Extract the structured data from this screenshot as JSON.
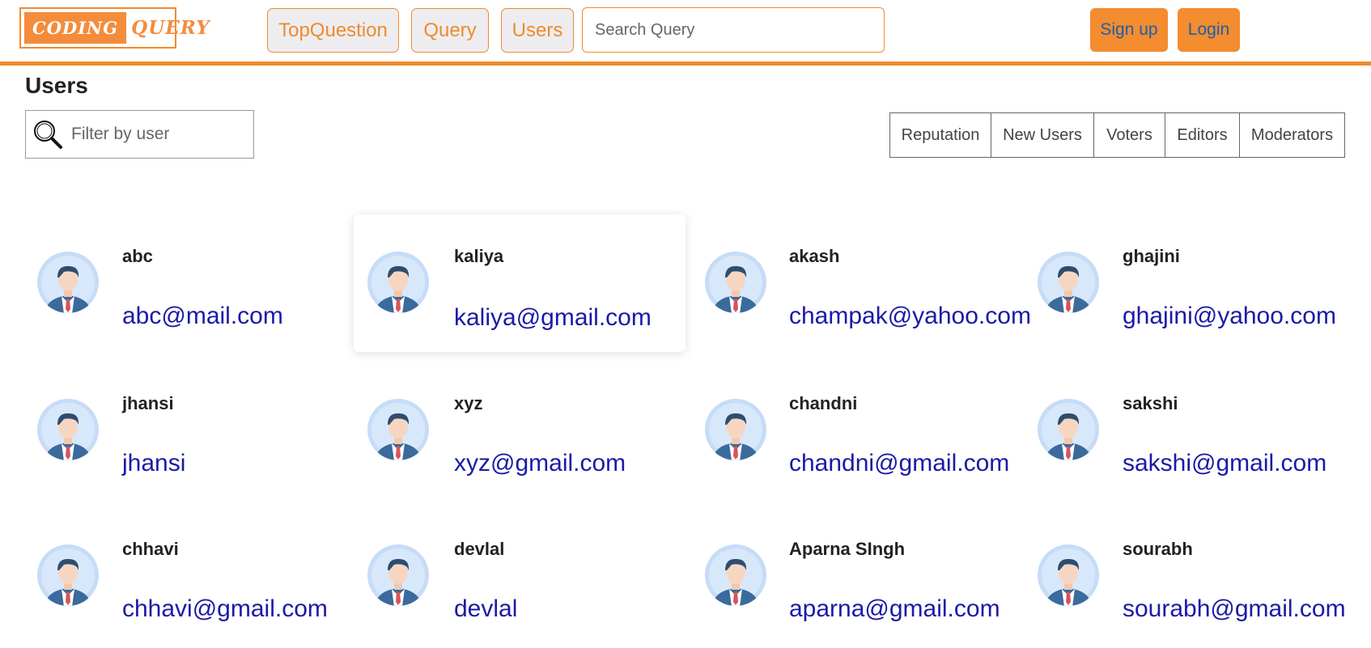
{
  "header": {
    "logo_left": "CODING",
    "logo_right": "QUERY",
    "nav": [
      "TopQuestion",
      "Query",
      "Users"
    ],
    "search_placeholder": "Search Query",
    "signup": "Sign up",
    "login": "Login"
  },
  "colors": {
    "accent": "#f08a2c",
    "link": "#1a1aa8",
    "auth_text": "#1a5faa"
  },
  "page": {
    "title": "Users",
    "filter_placeholder": "Filter by user",
    "tabs": [
      "Reputation",
      "New Users",
      "Voters",
      "Editors",
      "Moderators"
    ]
  },
  "users": [
    {
      "name": "abc",
      "email": "abc@mail.com"
    },
    {
      "name": "kaliya",
      "email": "kaliya@gmail.com"
    },
    {
      "name": "akash",
      "email": "champak@yahoo.com"
    },
    {
      "name": "ghajini",
      "email": "ghajini@yahoo.com"
    },
    {
      "name": "jhansi",
      "email": "jhansi"
    },
    {
      "name": "xyz",
      "email": "xyz@gmail.com"
    },
    {
      "name": "chandni",
      "email": "chandni@gmail.com"
    },
    {
      "name": "sakshi",
      "email": "sakshi@gmail.com"
    },
    {
      "name": "chhavi",
      "email": "chhavi@gmail.com"
    },
    {
      "name": "devlal",
      "email": "devlal"
    },
    {
      "name": "Aparna SIngh",
      "email": "aparna@gmail.com"
    },
    {
      "name": "sourabh",
      "email": "sourabh@gmail.com"
    }
  ]
}
